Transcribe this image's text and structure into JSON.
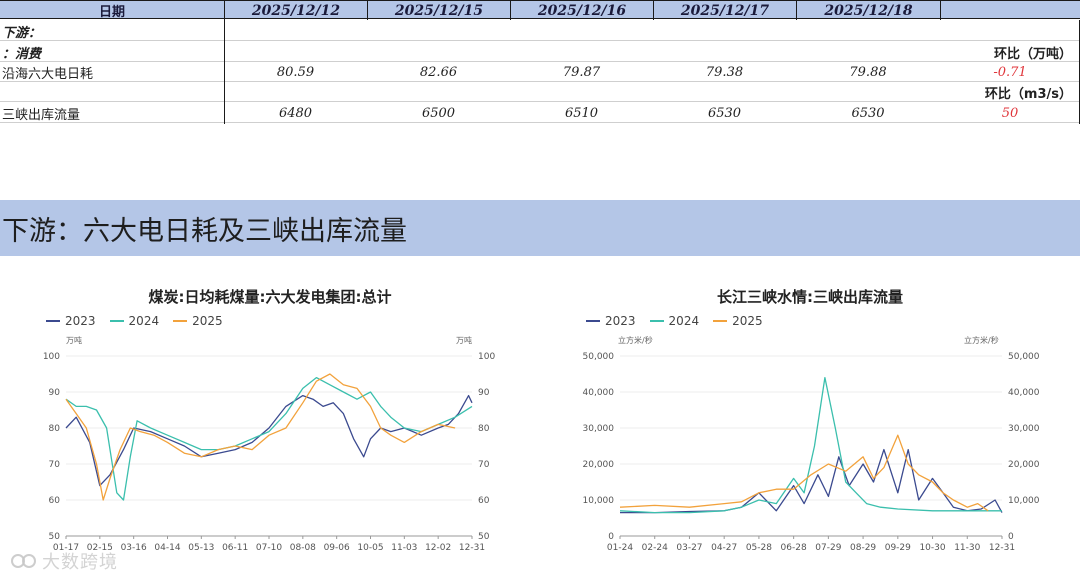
{
  "table": {
    "header": {
      "label": "日期",
      "dates": [
        "2025/12/12",
        "2025/12/15",
        "2025/12/16",
        "2025/12/17",
        "2025/12/18"
      ]
    },
    "section_label": "下游：",
    "sub_label": "：消费",
    "unit1": "环比（万吨）",
    "row1": {
      "label": "沿海六大电日耗",
      "values": [
        "80.59",
        "82.66",
        "79.87",
        "79.38",
        "79.88"
      ],
      "change": "-0.71"
    },
    "unit2": "环比（m3/s）",
    "row2": {
      "label": "三峡出库流量",
      "values": [
        "6480",
        "6500",
        "6510",
        "6530",
        "6530"
      ],
      "change": "50"
    }
  },
  "banner": {
    "title": "下游：六大电日耗及三峡出库流量"
  },
  "colors": {
    "s2023": "#3b4a8f",
    "s2024": "#3bbfad",
    "s2025": "#f2a23c",
    "header_bg": "#b4c6e7",
    "change_red": "#e0363b"
  },
  "watermark": {
    "text": "大数跨境",
    "icon": "logo-icon"
  },
  "chart_data": [
    {
      "type": "line",
      "title": "煤炭:日均耗煤量:六大发电集团:总计",
      "left_unit": "万吨",
      "right_unit": "万吨",
      "ylim": [
        50,
        100
      ],
      "yticks": [
        "100",
        "90",
        "80",
        "70",
        "60",
        "50"
      ],
      "xticks": [
        "01-17",
        "02-15",
        "03-16",
        "04-14",
        "05-13",
        "06-11",
        "07-10",
        "08-08",
        "09-06",
        "10-05",
        "11-03",
        "12-02",
        "12-31"
      ],
      "legend": [
        "2023",
        "2024",
        "2025"
      ],
      "series": [
        {
          "name": "2023",
          "x": [
            0,
            0.3,
            0.7,
            1.0,
            1.3,
            1.7,
            2.0,
            2.5,
            3.0,
            3.5,
            4.0,
            4.5,
            5.0,
            5.5,
            6.0,
            6.5,
            7.0,
            7.3,
            7.6,
            7.9,
            8.2,
            8.5,
            8.8,
            9.0,
            9.3,
            9.6,
            10.0,
            10.5,
            11.0,
            11.3,
            11.6,
            11.9,
            12.0
          ],
          "y": [
            80,
            83,
            76,
            64,
            67,
            74,
            80,
            79,
            77,
            75,
            72,
            73,
            74,
            76,
            80,
            86,
            89,
            88,
            86,
            87,
            84,
            77,
            72,
            77,
            80,
            79,
            80,
            78,
            80,
            81,
            84,
            89,
            87
          ]
        },
        {
          "name": "2024",
          "x": [
            0,
            0.3,
            0.6,
            0.9,
            1.2,
            1.5,
            1.7,
            1.9,
            2.1,
            2.5,
            3.0,
            3.5,
            4.0,
            4.5,
            5.0,
            5.5,
            6.0,
            6.5,
            7.0,
            7.4,
            7.8,
            8.2,
            8.6,
            9.0,
            9.3,
            9.6,
            10.0,
            10.5,
            11.0,
            11.5,
            12.0
          ],
          "y": [
            88,
            86,
            86,
            85,
            80,
            62,
            60,
            72,
            82,
            80,
            78,
            76,
            74,
            74,
            75,
            77,
            79,
            84,
            91,
            94,
            92,
            90,
            88,
            90,
            86,
            83,
            80,
            79,
            81,
            83,
            86
          ]
        },
        {
          "name": "2025",
          "x": [
            0,
            0.3,
            0.6,
            0.9,
            1.1,
            1.3,
            1.6,
            1.9,
            2.2,
            2.6,
            3.0,
            3.5,
            4.0,
            4.5,
            5.0,
            5.5,
            6.0,
            6.5,
            7.0,
            7.4,
            7.8,
            8.2,
            8.6,
            9.0,
            9.3,
            9.6,
            10.0,
            10.5,
            11.0,
            11.5
          ],
          "y": [
            88,
            84,
            80,
            70,
            60,
            66,
            74,
            80,
            79,
            78,
            76,
            73,
            72,
            74,
            75,
            74,
            78,
            80,
            87,
            93,
            95,
            92,
            91,
            86,
            80,
            78,
            76,
            79,
            81,
            80
          ]
        }
      ]
    },
    {
      "type": "line",
      "title": "长江三峡水情:三峡出库流量",
      "left_unit": "立方米/秒",
      "right_unit": "立方米/秒",
      "ylim": [
        0,
        50000
      ],
      "yticks_left": [
        "50,000",
        "40,000",
        "30,000",
        "20,000",
        "10,000",
        "0"
      ],
      "yticks_right": [
        "50,000",
        "40,000",
        "30,000",
        "20,000",
        "10,000",
        "0"
      ],
      "xticks": [
        "01-24",
        "02-24",
        "03-27",
        "04-27",
        "05-28",
        "06-28",
        "07-29",
        "08-29",
        "09-29",
        "10-30",
        "11-30",
        "12-31"
      ],
      "legend": [
        "2023",
        "2024",
        "2025"
      ],
      "series": [
        {
          "name": "2023",
          "x": [
            0,
            1,
            2,
            3,
            3.5,
            4,
            4.5,
            5,
            5.3,
            5.7,
            6.0,
            6.3,
            6.6,
            7.0,
            7.3,
            7.6,
            8.0,
            8.3,
            8.6,
            9.0,
            9.3,
            9.6,
            10.0,
            10.4,
            10.8,
            11.0
          ],
          "y": [
            6500,
            6500,
            6800,
            7000,
            8000,
            12000,
            7000,
            14000,
            9000,
            17000,
            11000,
            22000,
            14000,
            20000,
            15000,
            24000,
            12000,
            24000,
            10000,
            16000,
            12000,
            8000,
            7000,
            7500,
            10000,
            6500
          ]
        },
        {
          "name": "2024",
          "x": [
            0,
            1,
            2,
            3,
            3.5,
            4,
            4.5,
            5,
            5.3,
            5.6,
            5.9,
            6.2,
            6.5,
            6.8,
            7.1,
            7.5,
            8.0,
            9.0,
            10.0,
            11.0
          ],
          "y": [
            7000,
            6500,
            6500,
            7000,
            8000,
            10000,
            9000,
            16000,
            12000,
            25000,
            44000,
            30000,
            15000,
            12000,
            9000,
            8000,
            7500,
            7000,
            7000,
            7000
          ]
        },
        {
          "name": "2025",
          "x": [
            0,
            1,
            2,
            3,
            3.5,
            4,
            4.5,
            5,
            5.5,
            6,
            6.5,
            7,
            7.3,
            7.6,
            8.0,
            8.3,
            8.6,
            9.0,
            9.3,
            9.6,
            10.0,
            10.3,
            10.6
          ],
          "y": [
            8000,
            8500,
            8000,
            9000,
            9500,
            12000,
            13000,
            13000,
            17000,
            20000,
            18000,
            22000,
            16000,
            19000,
            28000,
            20000,
            17000,
            15000,
            12000,
            10000,
            8000,
            9000,
            7000
          ]
        }
      ]
    }
  ]
}
